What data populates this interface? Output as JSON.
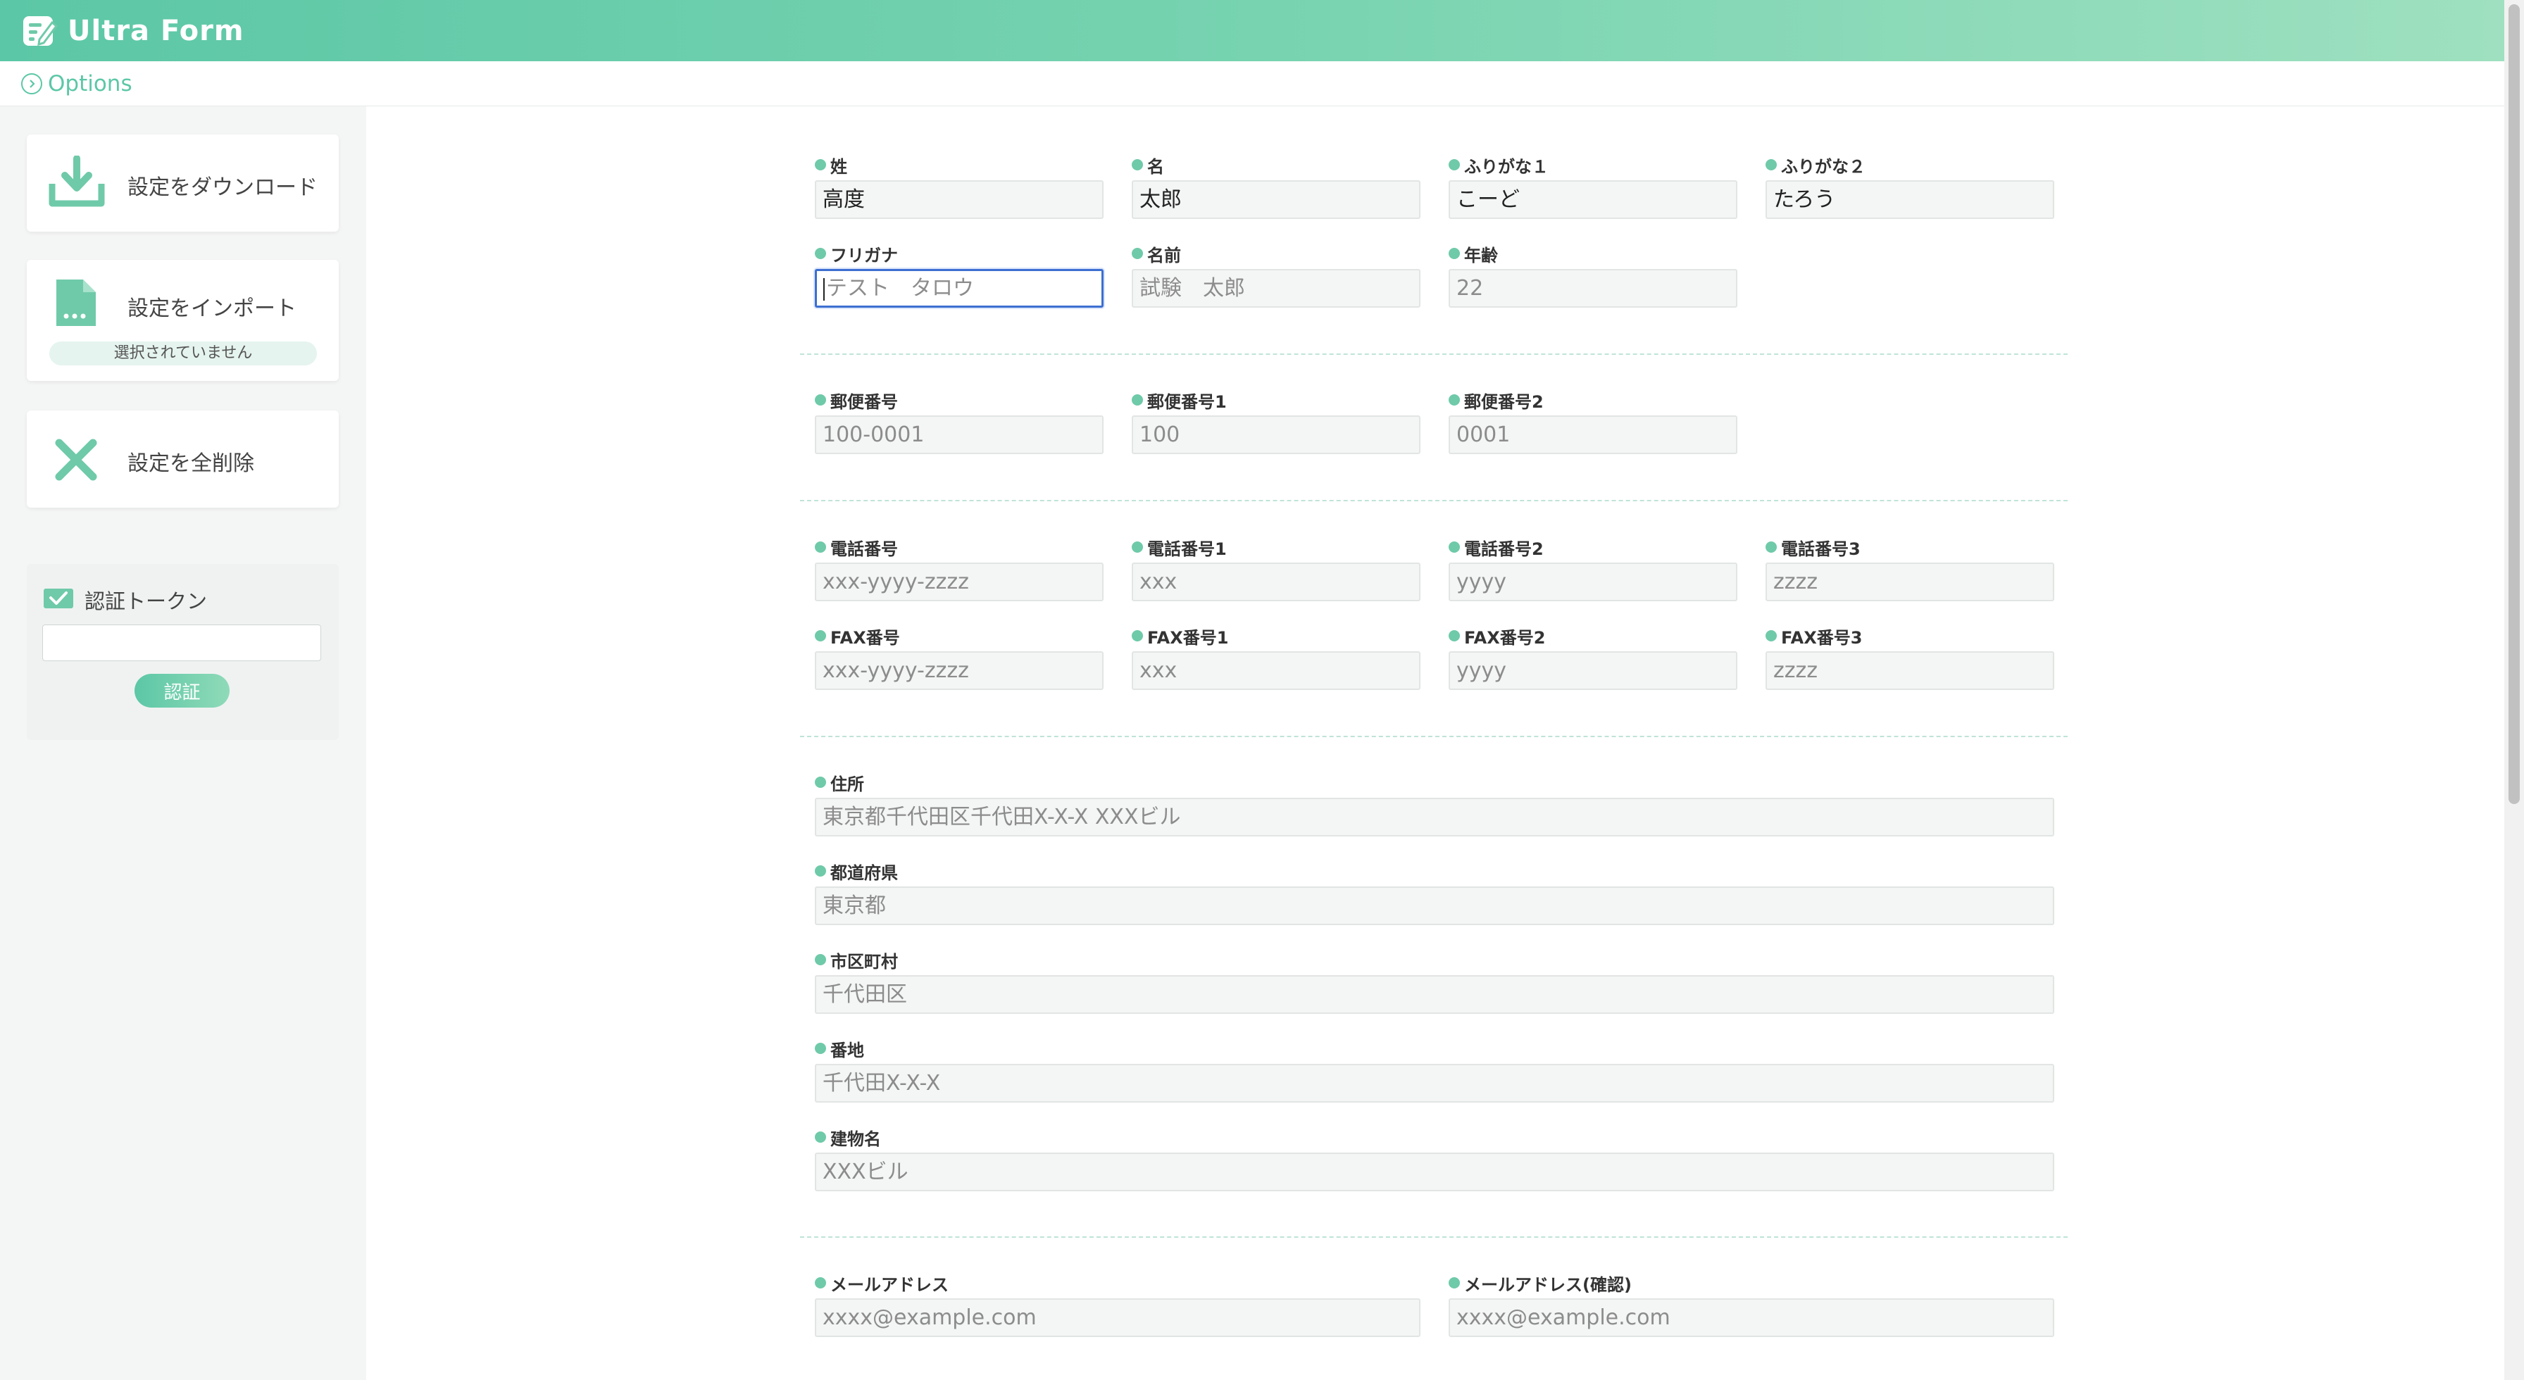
{
  "header": {
    "title": "Ultra Form"
  },
  "options_bar": {
    "label": "Options"
  },
  "sidebar": {
    "download_label": "設定をダウンロード",
    "import_label": "設定をインポート",
    "file_status": "選択されていません",
    "delete_label": "設定を全削除",
    "token_label": "認証トークン",
    "token_value": "",
    "auth_button": "認証"
  },
  "form": {
    "sei": {
      "label": "姓",
      "value": "高度"
    },
    "mei": {
      "label": "名",
      "value": "太郎"
    },
    "furigana1": {
      "label": "ふりがな１",
      "value": "こーど"
    },
    "furigana2": {
      "label": "ふりがな２",
      "value": "たろう"
    },
    "furigana_kana": {
      "label": "フリガナ",
      "placeholder": "テスト　タロウ"
    },
    "name": {
      "label": "名前",
      "placeholder": "試験　太郎"
    },
    "age": {
      "label": "年齢",
      "placeholder": "22"
    },
    "zip": {
      "label": "郵便番号",
      "placeholder": "100-0001"
    },
    "zip1": {
      "label": "郵便番号1",
      "placeholder": "100"
    },
    "zip2": {
      "label": "郵便番号2",
      "placeholder": "0001"
    },
    "tel": {
      "label": "電話番号",
      "placeholder": "xxx-yyyy-zzzz"
    },
    "tel1": {
      "label": "電話番号1",
      "placeholder": "xxx"
    },
    "tel2": {
      "label": "電話番号2",
      "placeholder": "yyyy"
    },
    "tel3": {
      "label": "電話番号3",
      "placeholder": "zzzz"
    },
    "fax": {
      "label": "FAX番号",
      "placeholder": "xxx-yyyy-zzzz"
    },
    "fax1": {
      "label": "FAX番号1",
      "placeholder": "xxx"
    },
    "fax2": {
      "label": "FAX番号2",
      "placeholder": "yyyy"
    },
    "fax3": {
      "label": "FAX番号3",
      "placeholder": "zzzz"
    },
    "address": {
      "label": "住所",
      "placeholder": "東京都千代田区千代田X-X-X XXXビル"
    },
    "prefecture": {
      "label": "都道府県",
      "placeholder": "東京都"
    },
    "city": {
      "label": "市区町村",
      "placeholder": "千代田区"
    },
    "street": {
      "label": "番地",
      "placeholder": "千代田X-X-X"
    },
    "building": {
      "label": "建物名",
      "placeholder": "XXXビル"
    },
    "email": {
      "label": "メールアドレス",
      "placeholder": "xxxx@example.com"
    },
    "email_confirm": {
      "label": "メールアドレス(確認)",
      "placeholder": "xxxx@example.com"
    }
  },
  "colors": {
    "accent": "#5cc7a6",
    "focus_border": "#3d6fd1"
  }
}
